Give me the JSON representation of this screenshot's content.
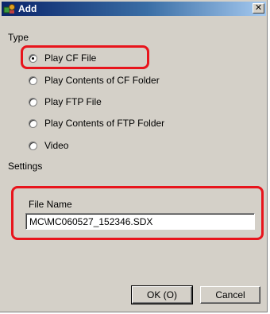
{
  "window": {
    "title": "Add",
    "close_glyph": "✕"
  },
  "type_section": {
    "label": "Type",
    "options": [
      {
        "label": "Play CF File",
        "checked": true
      },
      {
        "label": "Play Contents of CF Folder",
        "checked": false
      },
      {
        "label": "Play FTP File",
        "checked": false
      },
      {
        "label": "Play Contents of FTP Folder",
        "checked": false
      },
      {
        "label": "Video",
        "checked": false
      }
    ]
  },
  "settings_section": {
    "label": "Settings"
  },
  "file_name": {
    "label": "File Name",
    "value": "MC\\MC060527_152346.SDX"
  },
  "buttons": {
    "ok": "OK (O)",
    "cancel": "Cancel"
  },
  "colors": {
    "highlight": "#e8141c",
    "titlebar": "#0a246a",
    "dialog_bg": "#d4d0c8"
  }
}
